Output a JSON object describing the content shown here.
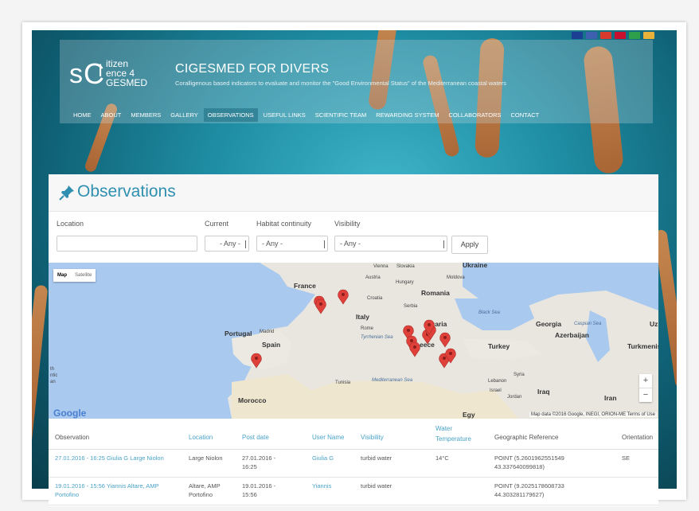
{
  "flags": [
    "#1c3f94",
    "#3f5fb0",
    "#d83a2e",
    "#c8102e",
    "#2e9f4a",
    "#e8b13a"
  ],
  "site": {
    "logo_prefix": "s",
    "logo_line1": "itizen",
    "logo_line2": "ence 4",
    "logo_line3": "GESMED",
    "title": "CIGESMED FOR DIVERS",
    "subtitle": "Coralligenous based indicators to evaluate and monitor the \"Good Environmental Status\" of the Mediterranean coastal waters"
  },
  "nav": [
    "HOME",
    "ABOUT",
    "MEMBERS",
    "GALLERY",
    "OBSERVATIONS",
    "USEFUL LINKS",
    "SCIENTIFIC TEAM",
    "REWARDING SYSTEM",
    "COLLABORATORS",
    "CONTACT"
  ],
  "nav_active": "OBSERVATIONS",
  "page": {
    "title": "Observations"
  },
  "filters": {
    "location_label": "Location",
    "location_value": "",
    "current_label": "Current",
    "current_value": "- Any -",
    "habitat_label": "Habitat continuity",
    "habitat_value": "- Any -",
    "visibility_label": "Visibility",
    "visibility_value": "- Any -",
    "apply_label": "Apply"
  },
  "map": {
    "type_map": "Map",
    "type_satellite": "Satellite",
    "labels": {
      "france": "France",
      "portugal": "Portugal",
      "madrid": "Madrid",
      "spain": "Spain",
      "italy": "Italy",
      "rome": "Rome",
      "austria": "Austria",
      "hungary": "Hungary",
      "slovakia": "Slovakia",
      "vienna": "Vienna",
      "ukraine": "Ukraine",
      "moldova": "Moldova",
      "romania": "Romania",
      "croatia": "Croatia",
      "serbia": "Serbia",
      "bulgaria": "garia",
      "greece": "eece",
      "turkey": "Turkey",
      "black_sea": "Black Sea",
      "georgia": "Georgia",
      "caspian": "Caspian Sea",
      "azerbaijan": "Azerbaijan",
      "turkmenistan": "Turkmenista",
      "uz": "Uz",
      "syria": "Syria",
      "lebanon": "Lebanon",
      "israel": "Israel",
      "jordan": "Jordan",
      "iraq": "Iraq",
      "iran": "Iran",
      "tunisia": "Tunisia",
      "morocco": "Morocco",
      "med_sea": "Mediterranean Sea",
      "tyrrhenian": "Tyrrhenian Sea",
      "atlantic": "th\nntic\nan",
      "egypt": "Egy"
    },
    "google": "Google",
    "credit": "Map data ©2016 Google, INEGI, ORION-ME   Terms of Use",
    "zoom_in": "+",
    "zoom_out": "−"
  },
  "table": {
    "headers": {
      "observation": "Observation",
      "location": "Location",
      "post_date": "Post date",
      "user_name": "User Name",
      "visibility": "Visibility",
      "water_temp": "Water Temperature",
      "geo": "Geographic Reference",
      "orientation": "Orientation"
    },
    "rows": [
      {
        "observation": "27.01.2016 - 16:25 Giulia G Large Niolon",
        "location": "Large Niolon",
        "post_date": "27.01.2016 - 16:25",
        "user_name": "Giulia G",
        "visibility": "turbid water",
        "water_temp": "14°C",
        "geo": "POINT (5.2601962551549 43.337640099818)",
        "orientation": "SE"
      },
      {
        "observation": "19.01.2016 - 15:56 Yiannis Altare, AMP Portofino",
        "location": "Altare, AMP Portofino",
        "post_date": "19.01.2016 - 15:56",
        "user_name": "Yiannis",
        "visibility": "turbid water",
        "water_temp": "",
        "geo": "POINT (9.2025178608733 44.303281179627)",
        "orientation": ""
      }
    ]
  }
}
